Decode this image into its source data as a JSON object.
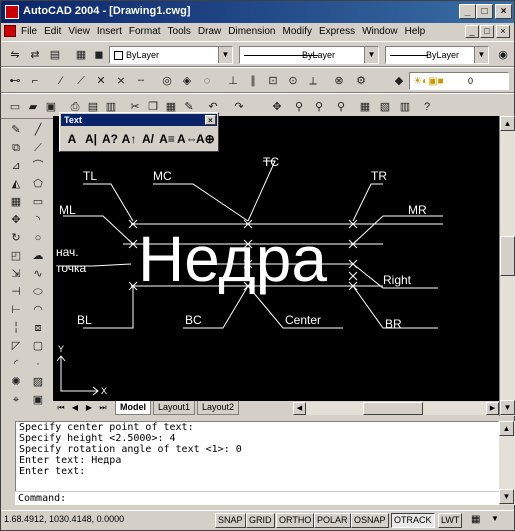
{
  "window": {
    "title": "AutoCAD 2004 - [Drawing1.cwg]",
    "minimize": "_",
    "maximize": "□",
    "close": "×"
  },
  "menu": [
    "File",
    "Edit",
    "View",
    "Insert",
    "Format",
    "Tools",
    "Draw",
    "Dimension",
    "Modify",
    "Express",
    "Window",
    "Help"
  ],
  "mdi_buttons": [
    "_",
    "□",
    "×"
  ],
  "properties_bar": {
    "layer_value": "0",
    "color_value": "ByLayer",
    "linetype_value": "ByLayer",
    "lineweight_value": "ByLayer"
  },
  "text_toolbar": {
    "title": "Text",
    "close": "×",
    "buttons": [
      "A",
      "A|",
      "A?",
      "A↑",
      "A/",
      "A≡",
      "A⇔",
      "A⊕"
    ]
  },
  "drawing": {
    "main_text": "Недра",
    "labels": {
      "tl": "TL",
      "mc": "MC",
      "tc": "TC",
      "tr": "TR",
      "ml": "ML",
      "mr": "MR",
      "start1": "нач.",
      "start2": "точка",
      "right": "Right",
      "bl": "BL",
      "bc": "BC",
      "center": "Center",
      "br": "BR",
      "y_axis": "Y",
      "x_axis": "X"
    }
  },
  "tabs": [
    "Model",
    "Layout1",
    "Layout2"
  ],
  "command_history": [
    "Specify center point of text:",
    "Specify height <2.5000>: 4",
    "Specify rotation angle of text <1>: 0",
    "Enter text: Недра",
    "Enter text:"
  ],
  "command_prompt": "Command:",
  "status": {
    "coords": "1.68.4912, 1030.4148, 0.0000",
    "buttons": [
      {
        "label": "SNAP",
        "on": false
      },
      {
        "label": "GRID",
        "on": false
      },
      {
        "label": "ORTHO",
        "on": false
      },
      {
        "label": "POLAR",
        "on": false
      },
      {
        "label": "OSNAP",
        "on": false
      },
      {
        "label": "OTRACK",
        "on": true
      },
      {
        "label": "LWT",
        "on": false
      }
    ]
  }
}
